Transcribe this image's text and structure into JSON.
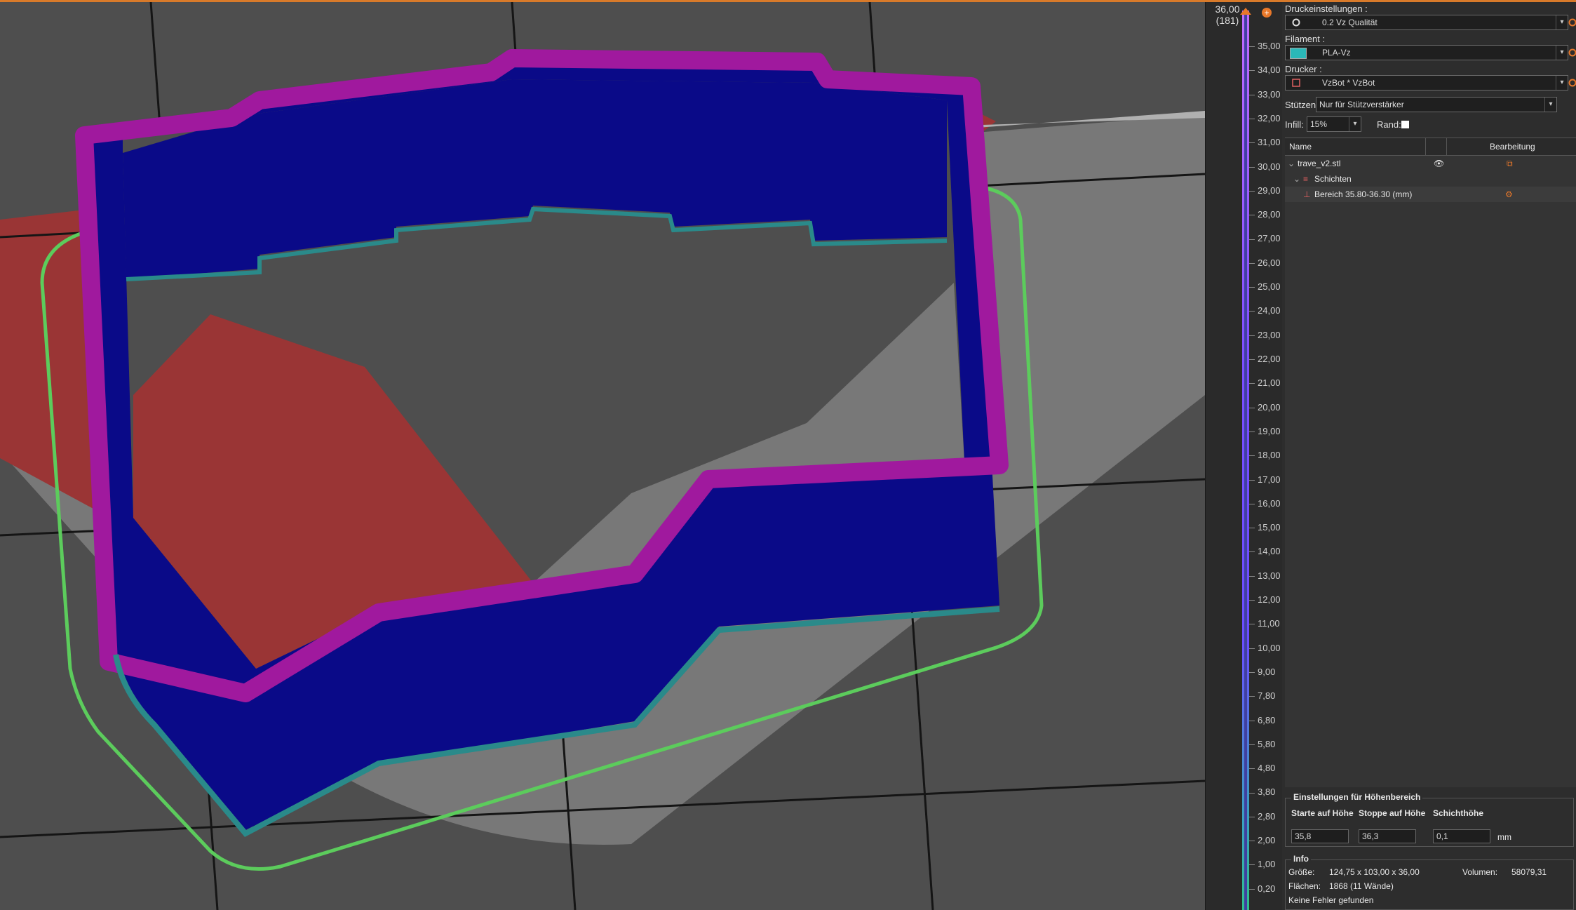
{
  "slider": {
    "top_value": "36,00",
    "top_layer": "(181)",
    "ticks": [
      "35,00",
      "34,00",
      "33,00",
      "32,00",
      "31,00",
      "30,00",
      "29,00",
      "28,00",
      "27,00",
      "26,00",
      "25,00",
      "24,00",
      "23,00",
      "22,00",
      "21,00",
      "20,00",
      "19,00",
      "18,00",
      "17,00",
      "16,00",
      "15,00",
      "14,00",
      "13,00",
      "12,00",
      "11,00",
      "10,00",
      "9,00",
      "7,80",
      "6,80",
      "5,80",
      "4,80",
      "3,80",
      "2,80",
      "2,00",
      "1,00",
      "0,20"
    ]
  },
  "panel": {
    "print_settings_label": "Druckeinstellungen :",
    "print_settings_value": "0.2 Vz Qualität",
    "filament_label": "Filament :",
    "filament_value": "PLA-Vz",
    "filament_color": "#2bb8b8",
    "printer_label": "Drucker :",
    "printer_value": "VzBot * VzBot",
    "supports_label": "Stützen:",
    "supports_value": "Nur für Stützverstärker",
    "infill_label": "Infill:",
    "infill_value": "15%",
    "brim_label": "Rand:",
    "tree": {
      "col_name": "Name",
      "col_edit": "Bearbeitung",
      "object": "trave_v2.stl",
      "layers": "Schichten",
      "range": "Bereich 35.80-36.30 (mm)"
    },
    "height_range": {
      "title": "Einstellungen für Höhenbereich",
      "start_label": "Starte auf Höhe",
      "stop_label": "Stoppe auf Höhe",
      "layer_label": "Schichthöhe",
      "start_value": "35,8",
      "stop_value": "36,3",
      "layer_value": "0,1",
      "unit": "mm"
    },
    "info": {
      "title": "Info",
      "size_label": "Größe:",
      "size_value": "124,75 x 103,00 x 36,00",
      "volume_label": "Volumen:",
      "volume_value": "58079,31",
      "faces_label": "Flächen:",
      "faces_value": "1868 (11 Wände)",
      "errors": "Keine Fehler gefunden"
    }
  },
  "colors": {
    "accent": "#e8782a",
    "wall": "#0a0a8a",
    "top": "#9a1a9a",
    "skirt": "#5ccc5c",
    "bed_red": "#9a3535"
  }
}
